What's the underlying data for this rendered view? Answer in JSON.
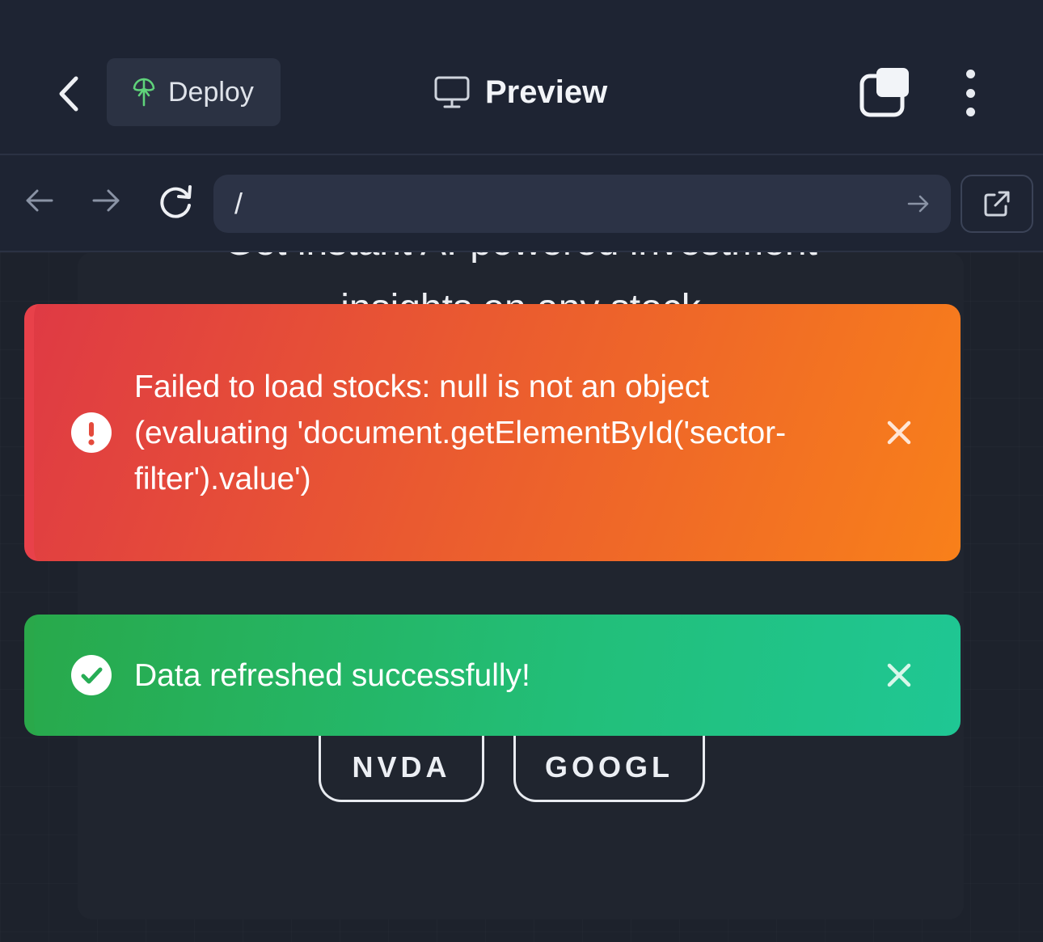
{
  "header": {
    "deploy_label": "Deploy",
    "title": "Preview",
    "icons": [
      "chevron-left-icon",
      "antenna-icon",
      "monitor-icon",
      "tabs-icon",
      "more-vertical-icon"
    ]
  },
  "browser": {
    "url": "/",
    "icons": [
      "arrow-left-icon",
      "arrow-right-icon",
      "reload-icon",
      "go-arrow-icon",
      "external-link-icon"
    ]
  },
  "page": {
    "hero_line1": "Get instant AI-powered investment",
    "hero_line2": "insights on any stock",
    "tickers": [
      "NVDA",
      "GOOGL"
    ]
  },
  "toasts": {
    "error": {
      "message": "Failed to load stocks: null is not an object (evaluating 'document.getElementById('sector-filter').value')",
      "color": "#e8414a"
    },
    "success": {
      "message": "Data refreshed successfully!",
      "color": "#22bf7a"
    }
  },
  "colors": {
    "app_bg": "#1e2433",
    "accent_green": "#5fd37a"
  }
}
